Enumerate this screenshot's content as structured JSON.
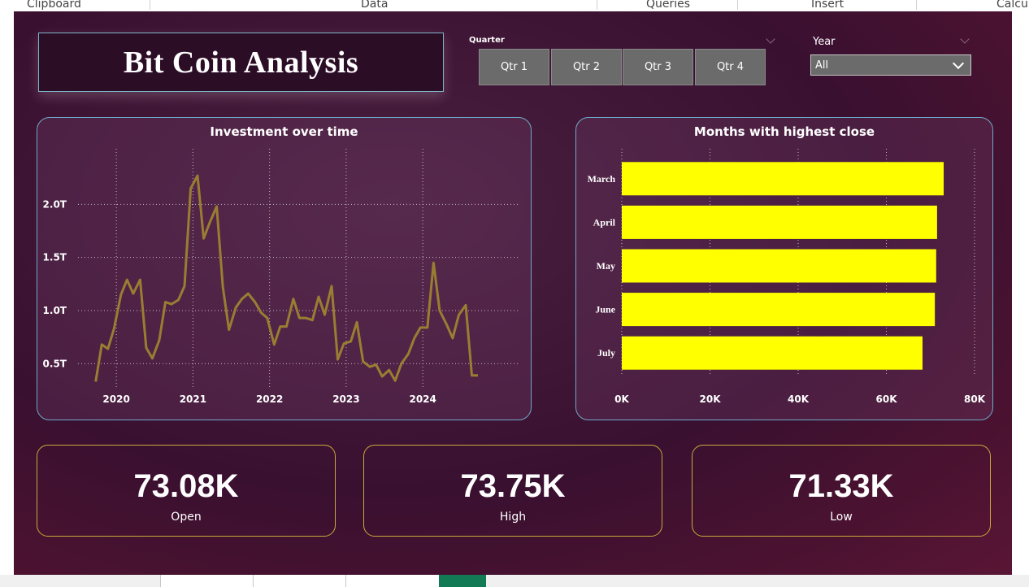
{
  "ribbon": {
    "groups": [
      "Clipboard",
      "Data",
      "Queries",
      "Insert",
      "Calcul"
    ]
  },
  "title": "Bit Coin Analysis",
  "quarter_slicer": {
    "label": "Quarter",
    "buttons": [
      "Qtr 1",
      "Qtr 2",
      "Qtr 3",
      "Qtr 4"
    ]
  },
  "year_slicer": {
    "label": "Year",
    "selected": "All"
  },
  "colors": {
    "line": "#9a7d32",
    "bar": "#ffff00",
    "panel_border": "#6fa8c8",
    "kpi_border": "#c9a93a"
  },
  "chart_data": [
    {
      "type": "line",
      "title": "Investment over time",
      "x_ticks": [
        "2020",
        "2021",
        "2022",
        "2023",
        "2024"
      ],
      "y_ticks": [
        "0.5T",
        "1.0T",
        "1.5T",
        "2.0T"
      ],
      "ylim": [
        0.15,
        2.6
      ],
      "xlim": [
        2019.5,
        2025.25
      ],
      "grid": true,
      "series": [
        {
          "x": [
            2019.73,
            2019.81,
            2019.89,
            2019.97,
            2020.06,
            2020.14,
            2020.22,
            2020.31,
            2020.39,
            2020.47,
            2020.56,
            2020.64,
            2020.72,
            2020.81,
            2020.89,
            2020.97,
            2021.06,
            2021.14,
            2021.22,
            2021.31,
            2021.39,
            2021.47,
            2021.56,
            2021.64,
            2021.72,
            2021.81,
            2021.89,
            2021.97,
            2022.06,
            2022.14,
            2022.22,
            2022.31,
            2022.39,
            2022.47,
            2022.56,
            2022.64,
            2022.72,
            2022.81,
            2022.89,
            2022.97,
            2023.06,
            2023.14,
            2023.22,
            2023.31,
            2023.39,
            2023.47,
            2023.56,
            2023.64,
            2023.72,
            2023.81,
            2023.89,
            2023.97,
            2024.06,
            2024.14,
            2024.22,
            2024.31,
            2024.39,
            2024.47,
            2024.56,
            2024.64,
            2024.72
          ],
          "y": [
            0.33,
            0.68,
            0.64,
            0.83,
            1.15,
            1.29,
            1.16,
            1.29,
            0.65,
            0.55,
            0.72,
            1.08,
            1.06,
            1.1,
            1.23,
            2.15,
            2.27,
            1.68,
            1.83,
            1.98,
            1.22,
            0.82,
            1.03,
            1.11,
            1.16,
            1.08,
            0.98,
            0.93,
            0.68,
            0.85,
            0.85,
            1.11,
            0.93,
            0.93,
            0.91,
            1.13,
            0.96,
            1.23,
            0.54,
            0.69,
            0.71,
            0.89,
            0.52,
            0.47,
            0.49,
            0.38,
            0.44,
            0.34,
            0.5,
            0.59,
            0.74,
            0.84,
            0.84,
            1.45,
            1.0,
            0.87,
            0.74,
            0.96,
            1.05,
            0.39,
            0.39
          ]
        }
      ]
    },
    {
      "type": "bar",
      "orientation": "horizontal",
      "title": "Months with highest close",
      "categories": [
        "March",
        "April",
        "May",
        "June",
        "July"
      ],
      "values": [
        73000,
        71500,
        71300,
        71000,
        68200
      ],
      "x_ticks": [
        "0K",
        "20K",
        "40K",
        "60K",
        "80K"
      ],
      "xlim": [
        0,
        80000
      ],
      "grid": true
    }
  ],
  "kpis": [
    {
      "value": "73.08K",
      "label": "Open"
    },
    {
      "value": "73.75K",
      "label": "High"
    },
    {
      "value": "71.33K",
      "label": "Low"
    }
  ]
}
